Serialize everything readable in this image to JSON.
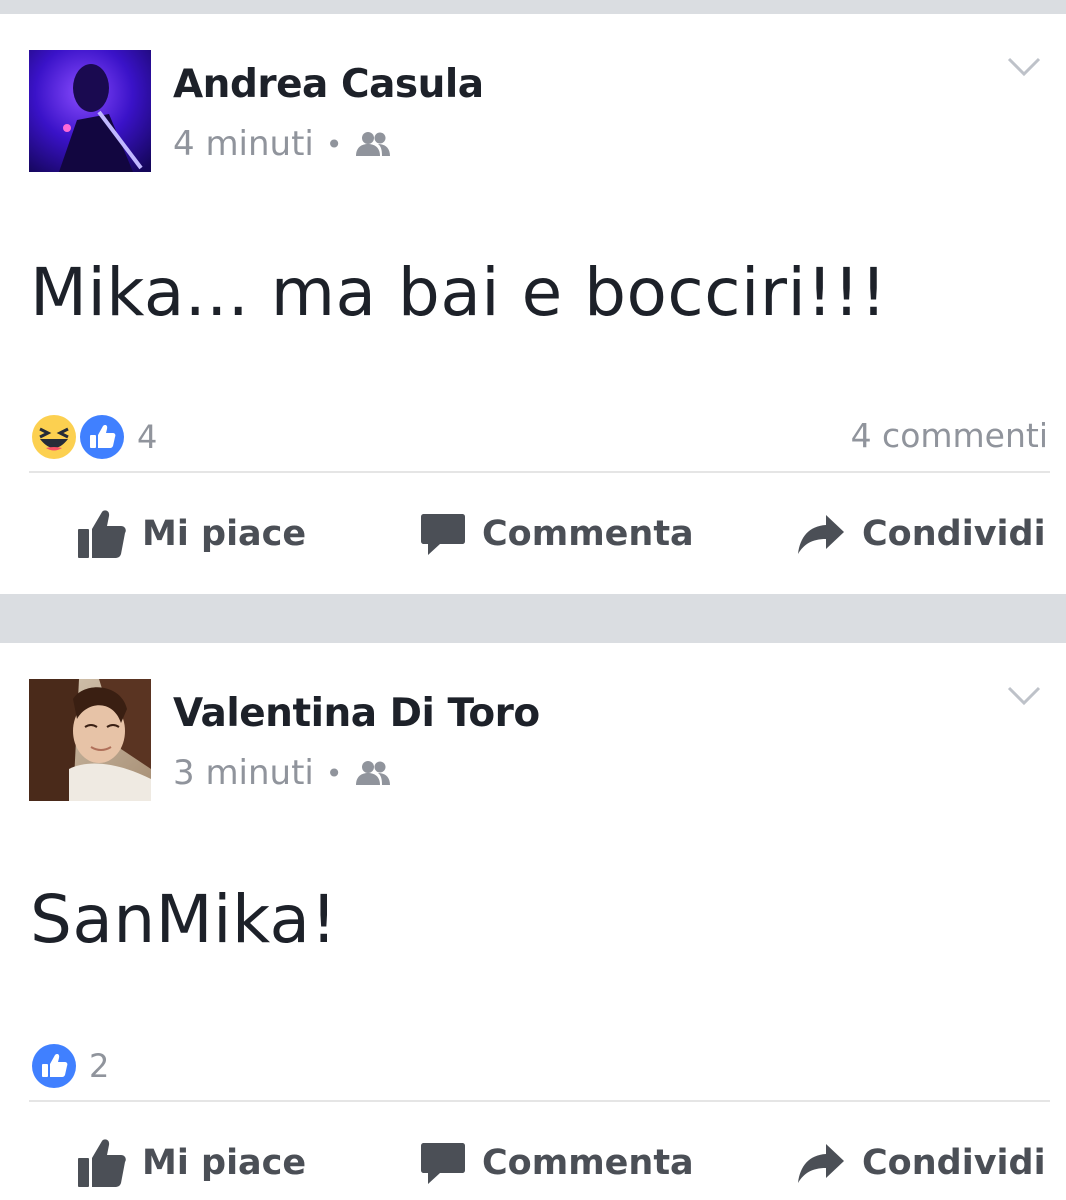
{
  "posts": [
    {
      "author": "Andrea Casula",
      "time": "4 minuti",
      "separator": "•",
      "audience_icon": "friends-icon",
      "text": "Mika... ma bai e bocciri!!!",
      "reactions": [
        "haha-icon",
        "like-icon"
      ],
      "reaction_count": "4",
      "comments": "4 commenti"
    },
    {
      "author": "Valentina Di Toro",
      "time": "3 minuti",
      "separator": "•",
      "audience_icon": "friends-icon",
      "text": "SanMika!",
      "reactions": [
        "like-icon"
      ],
      "reaction_count": "2",
      "comments": ""
    }
  ],
  "actions": {
    "like_label": "Mi piace",
    "comment_label": "Commenta",
    "share_label": "Condividi"
  },
  "colors": {
    "feed_background": "#dadde1",
    "like_blue": "#4080ff",
    "haha_yellow": "#fcd050",
    "secondary_text": "#90949c"
  }
}
